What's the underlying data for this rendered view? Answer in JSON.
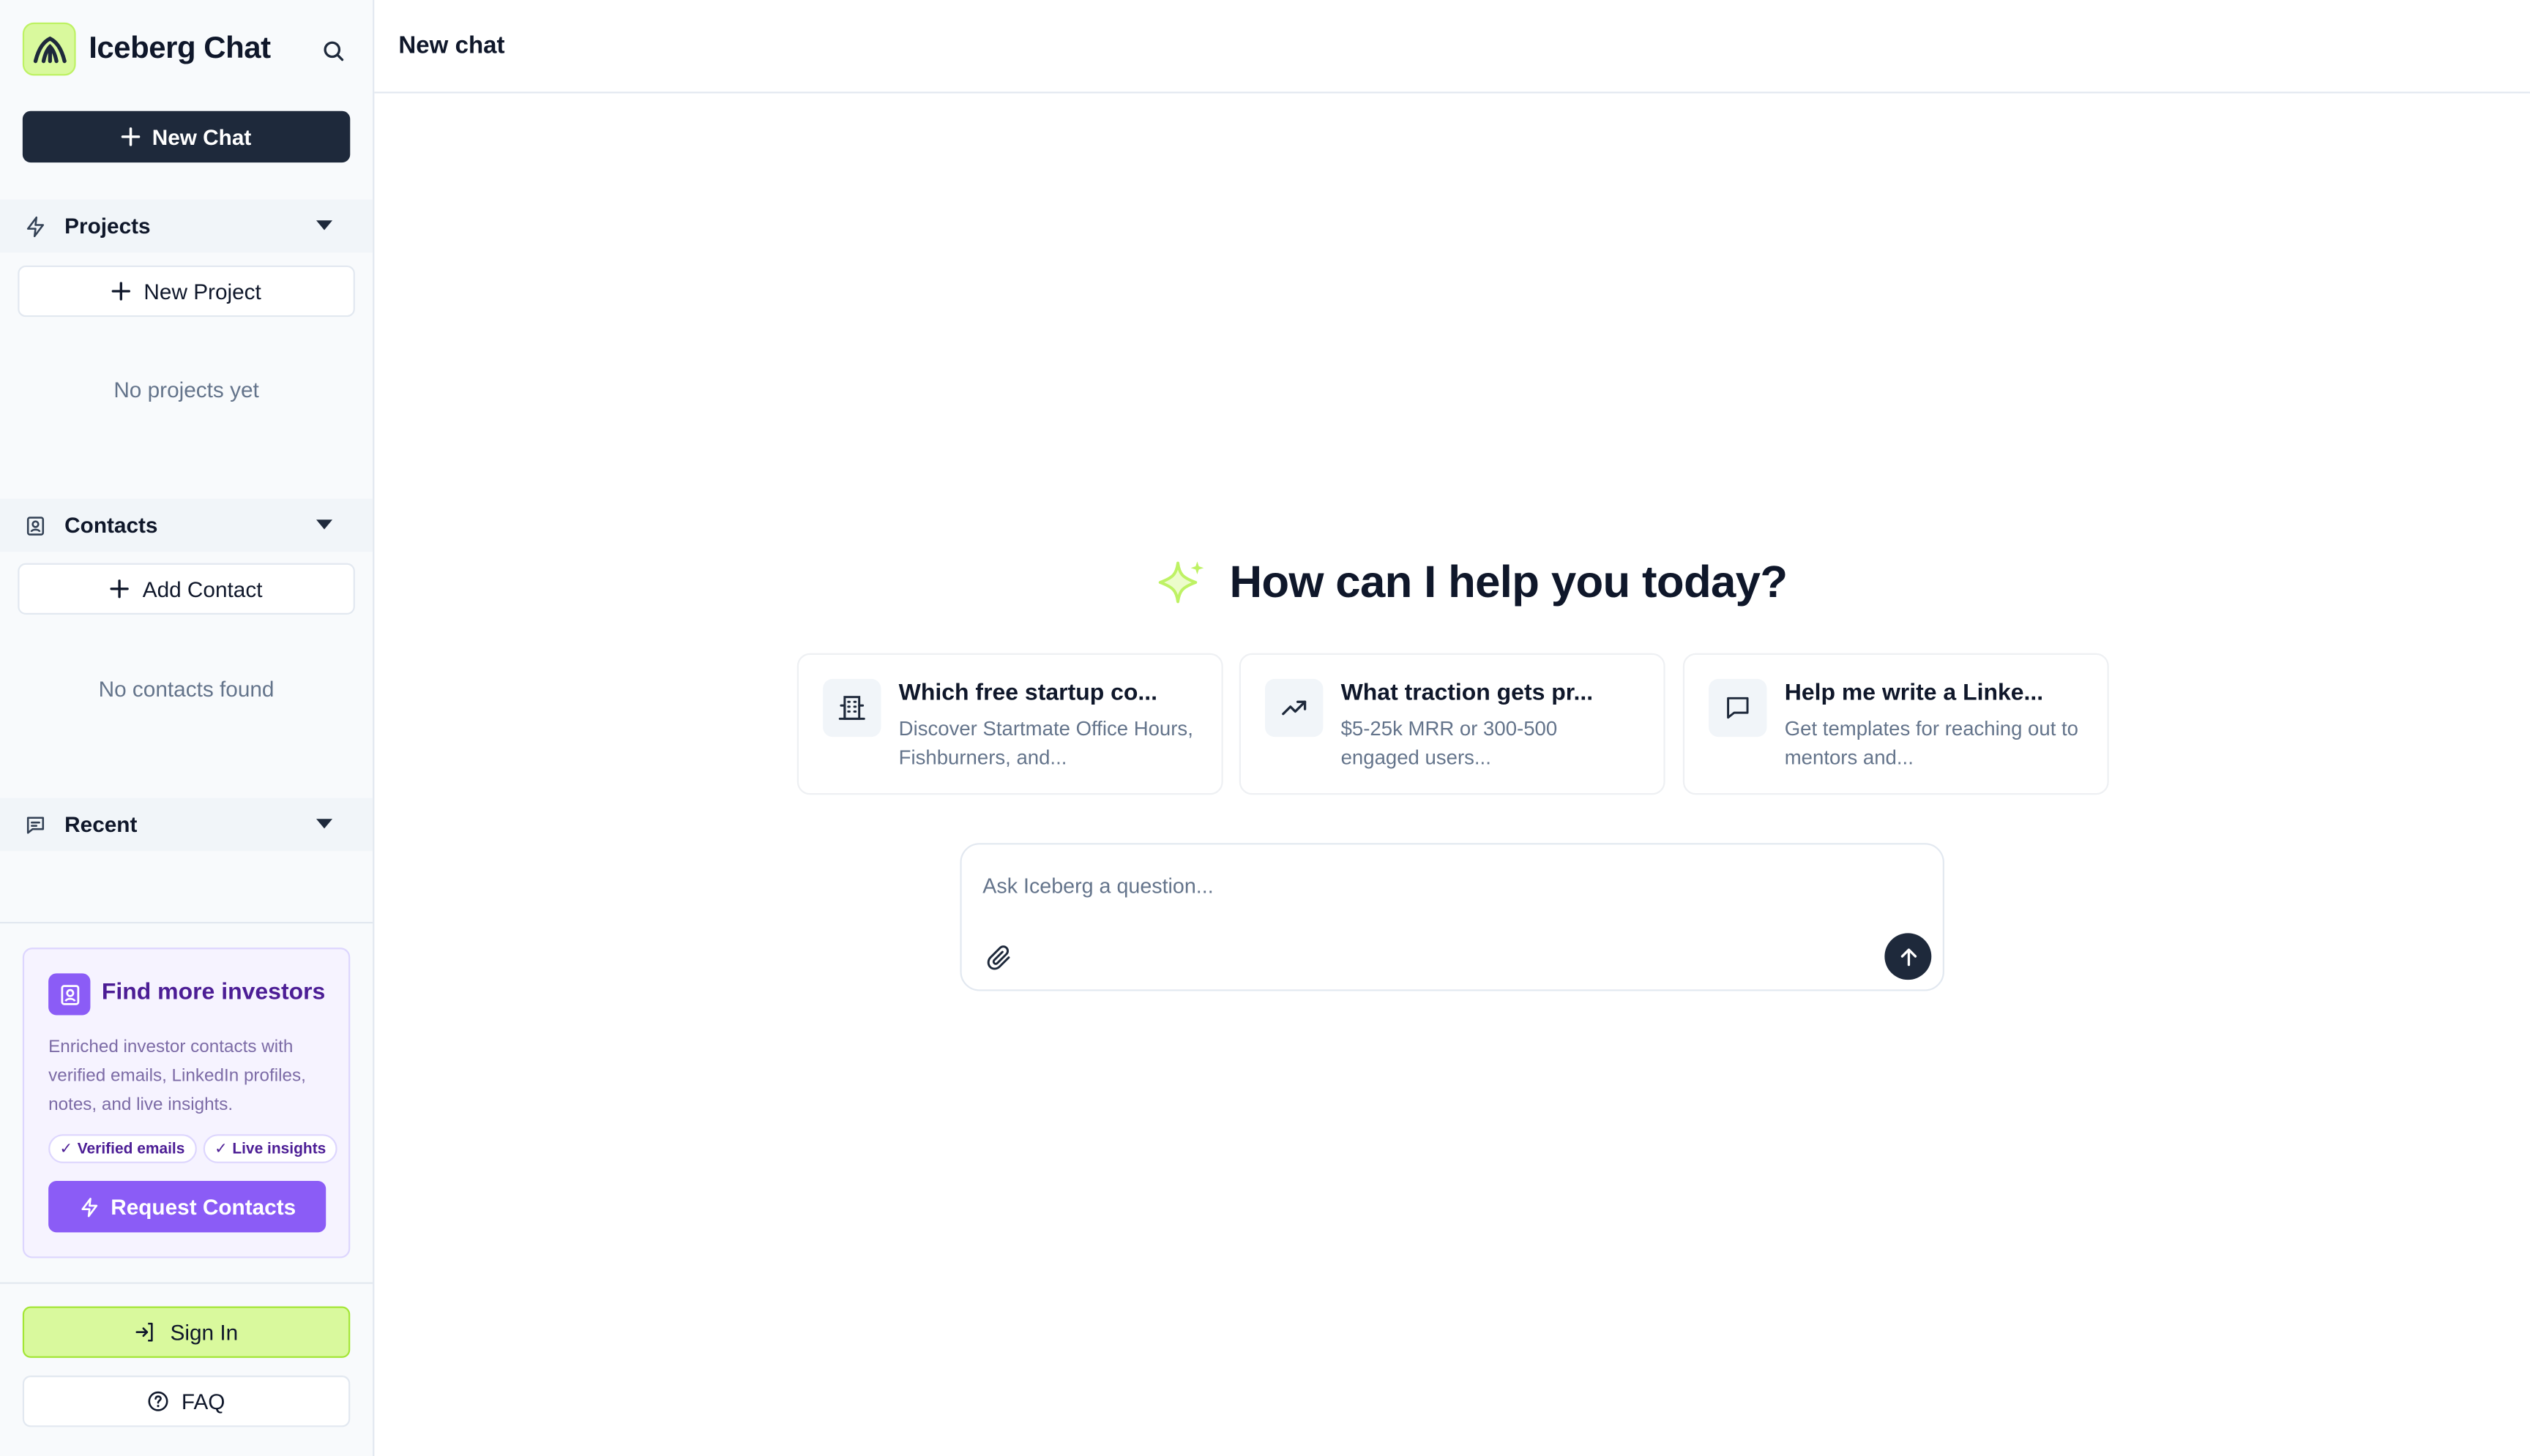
{
  "app": {
    "name": "Iceberg Chat"
  },
  "sidebar": {
    "new_chat_label": "New Chat",
    "projects": {
      "label": "Projects",
      "add_label": "New Project",
      "empty": "No projects yet"
    },
    "contacts": {
      "label": "Contacts",
      "add_label": "Add Contact",
      "empty": "No contacts found"
    },
    "recent": {
      "label": "Recent"
    },
    "promo": {
      "title": "Find more investors",
      "description": "Enriched investor contacts with verified emails, LinkedIn profiles, notes, and live insights.",
      "chips": [
        "Verified emails",
        "Live insights"
      ],
      "button_label": "Request Contacts"
    },
    "sign_in_label": "Sign In",
    "faq_label": "FAQ"
  },
  "header": {
    "title": "New chat"
  },
  "main": {
    "hero_title": "How can I help you today?",
    "suggestions": [
      {
        "icon": "building-icon",
        "title": "Which free startup co...",
        "description": "Discover Startmate Office Hours, Fishburners, and..."
      },
      {
        "icon": "trending-up-icon",
        "title": "What traction gets pr...",
        "description": "$5-25k MRR or 300-500 engaged users..."
      },
      {
        "icon": "message-square-icon",
        "title": "Help me write a Linke...",
        "description": "Get templates for reaching out to mentors and..."
      }
    ],
    "composer": {
      "placeholder": "Ask Iceberg a question...",
      "value": ""
    }
  },
  "colors": {
    "primary_dark": "#1e293b",
    "accent_lime": "#d9f99d",
    "accent_purple": "#8b5cf6",
    "sparkle": "#bef264"
  }
}
